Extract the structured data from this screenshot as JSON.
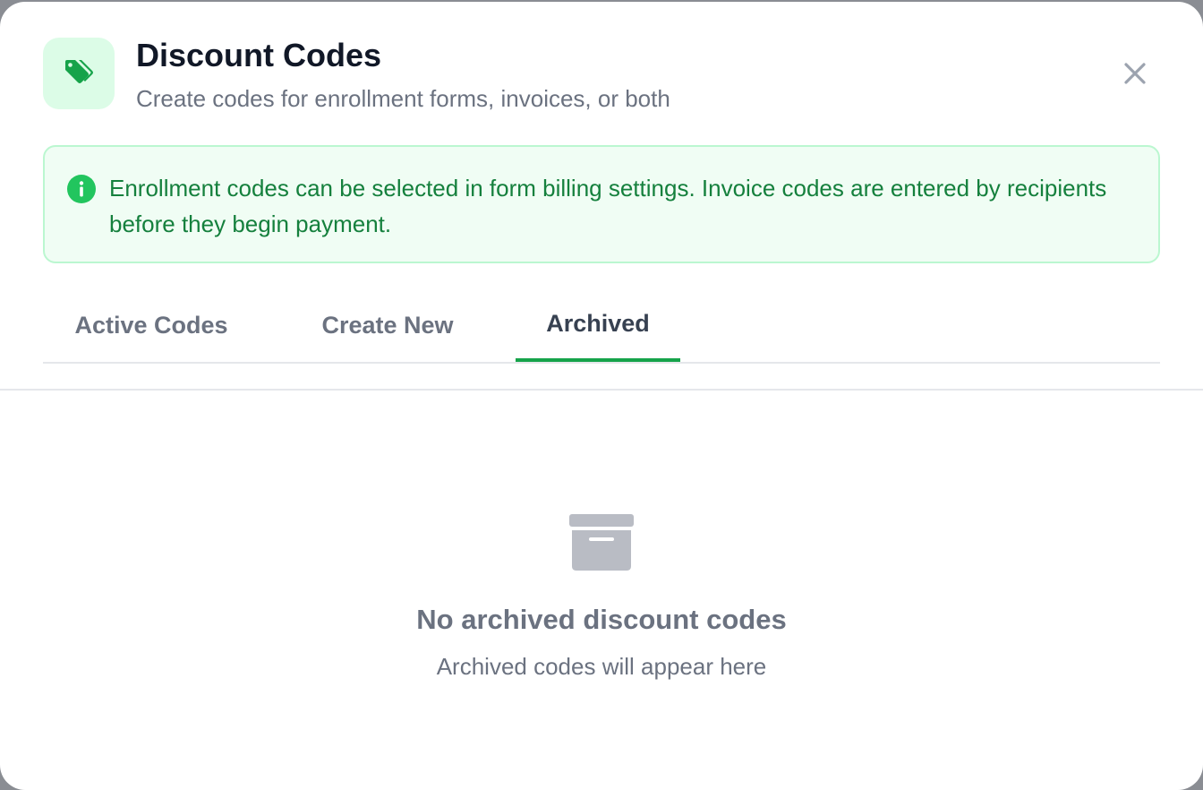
{
  "header": {
    "icon": "tags-icon",
    "title": "Discount Codes",
    "subtitle": "Create codes for enrollment forms, invoices, or both",
    "close_icon": "close-icon"
  },
  "info_banner": {
    "icon": "info-icon",
    "text": "Enrollment codes can be selected in form billing settings. Invoice codes are entered by recipients before they begin payment."
  },
  "tabs": [
    {
      "label": "Active Codes",
      "active": false
    },
    {
      "label": "Create New",
      "active": false
    },
    {
      "label": "Archived",
      "active": true
    }
  ],
  "empty_state": {
    "icon": "archive-box-icon",
    "title": "No archived discount codes",
    "subtitle": "Archived codes will appear here"
  },
  "colors": {
    "accent": "#16a34a",
    "accent_bg": "#dcfce7",
    "banner_bg": "#f0fdf4",
    "banner_border": "#bbf7d0",
    "banner_text": "#15803d",
    "title": "#111827",
    "muted": "#6b7280"
  }
}
